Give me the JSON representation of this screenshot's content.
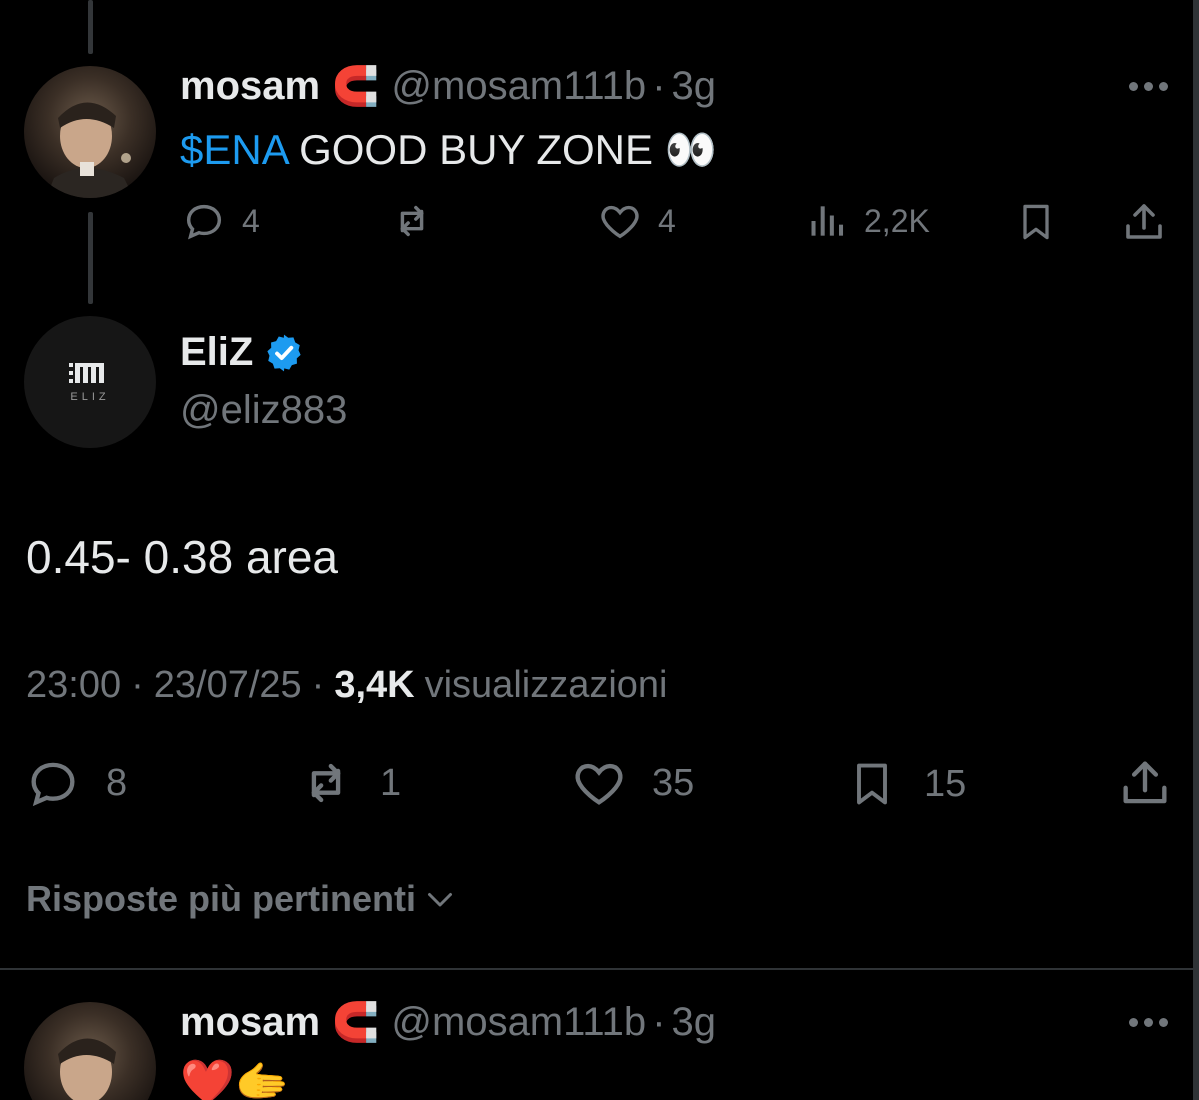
{
  "parent_tweet": {
    "name": "mosam",
    "name_emoji": "🧲",
    "handle": "@mosam111b",
    "separator": "·",
    "time": "3g",
    "cashtag": "$ENA",
    "text": " GOOD BUY ZONE 👀",
    "actions": {
      "replies": "4",
      "reposts": "",
      "likes": "4",
      "views": "2,2K"
    }
  },
  "main_tweet": {
    "name": "EliZ",
    "verified": true,
    "handle": "@eliz883",
    "avatar_logo_text": "ELIZ",
    "text": "0.45- 0.38 area",
    "timestamp_time": "23:00",
    "timestamp_sep1": "·",
    "timestamp_date": "23/07/25",
    "timestamp_sep2": "·",
    "views_count": "3,4K",
    "views_label": "visualizzazioni",
    "actions": {
      "replies": "8",
      "reposts": "1",
      "likes": "35",
      "bookmarks": "15"
    }
  },
  "replies_sort": {
    "label": "Risposte più pertinenti"
  },
  "reply_tweet": {
    "name": "mosam",
    "name_emoji": "🧲",
    "handle": "@mosam111b",
    "separator": "·",
    "time": "3g",
    "text": "❤️🫱"
  },
  "colors": {
    "background": "#000000",
    "text": "#e7e9ea",
    "muted": "#71767b",
    "accent": "#1d9bf0",
    "divider": "#2f3336"
  },
  "icons": [
    "reply-icon",
    "repost-icon",
    "like-icon",
    "views-icon",
    "bookmark-icon",
    "share-icon",
    "more-icon",
    "verified-icon",
    "chevron-down-icon"
  ]
}
